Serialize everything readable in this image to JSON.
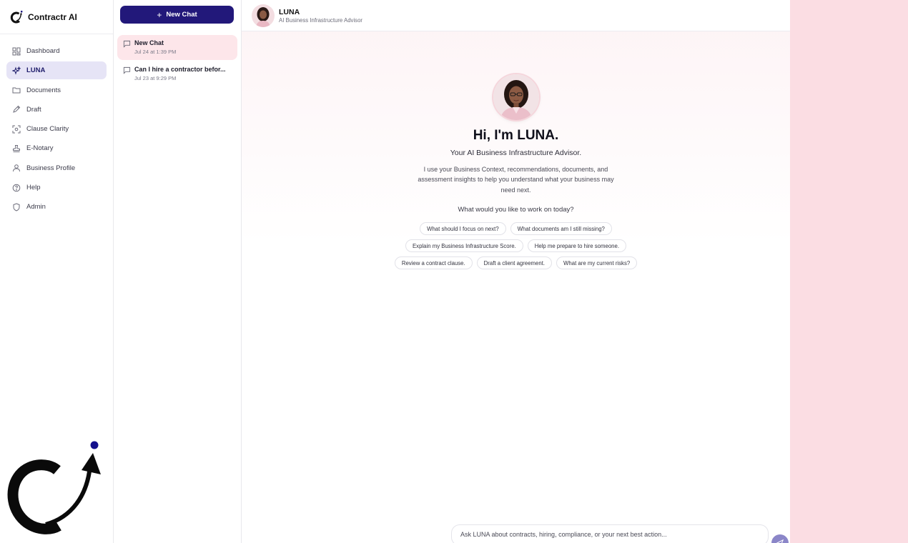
{
  "brand": {
    "name": "Contractr AI"
  },
  "sidebar": {
    "items": [
      {
        "label": "Dashboard",
        "icon": "grid-icon",
        "active": false
      },
      {
        "label": "LUNA",
        "icon": "sparkle-icon",
        "active": true
      },
      {
        "label": "Documents",
        "icon": "folder-icon",
        "active": false
      },
      {
        "label": "Draft",
        "icon": "pen-icon",
        "active": false
      },
      {
        "label": "Clause Clarity",
        "icon": "scan-icon",
        "active": false
      },
      {
        "label": "E-Notary",
        "icon": "stamp-icon",
        "active": false
      },
      {
        "label": "Business Profile",
        "icon": "user-icon",
        "active": false
      },
      {
        "label": "Help",
        "icon": "help-circle-icon",
        "active": false
      },
      {
        "label": "Admin",
        "icon": "shield-icon",
        "active": false
      }
    ]
  },
  "history": {
    "new_chat_label": "New Chat",
    "chats": [
      {
        "title": "New Chat",
        "date": "Jul 24 at 1:39 PM",
        "active": true
      },
      {
        "title": "Can I hire a contractor befor...",
        "date": "Jul 23 at 9:29 PM",
        "active": false
      }
    ]
  },
  "header": {
    "name": "LUNA",
    "subtitle": "AI Business Infrastructure Advisor"
  },
  "hero": {
    "title": "Hi, I'm LUNA.",
    "subtitle": "Your AI Business Infrastructure Advisor.",
    "description": "I use your Business Context, recommendations, documents, and assessment insights to help you understand what your business may need next.",
    "prompt": "What would you like to work on today?"
  },
  "suggestions": [
    [
      "What should I focus on next?",
      "What documents am I still missing?"
    ],
    [
      "Explain my Business Infrastructure Score.",
      "Help me prepare to hire someone."
    ],
    [
      "Review a contract clause.",
      "Draft a client agreement.",
      "What are my current risks?"
    ]
  ],
  "composer": {
    "placeholder": "Ask LUNA about contracts, hiring, compliance, or your next best action..."
  },
  "colors": {
    "primary": "#22187a",
    "active_nav_bg": "#e6e4f6",
    "active_chat_bg": "#fde6ea",
    "right_panel": "#fbdde3"
  }
}
